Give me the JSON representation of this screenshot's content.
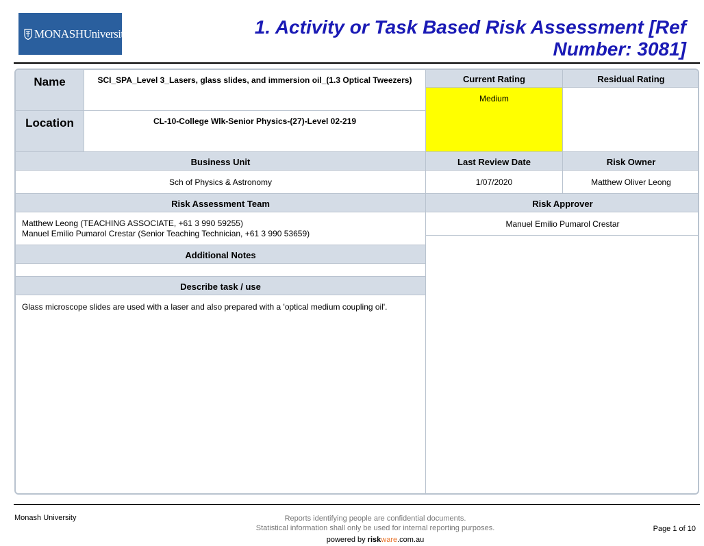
{
  "header": {
    "logo_main": "MONASH",
    "logo_sub": "University",
    "title": "1. Activity or Task Based Risk Assessment [Ref Number: 3081]"
  },
  "form": {
    "name_label": "Name",
    "name_value": "SCI_SPA_Level 3_Lasers, glass slides, and immersion oil_(1.3 Optical Tweezers)",
    "location_label": "Location",
    "location_value": "CL-10-College Wlk-Senior Physics-(27)-Level 02-219",
    "current_rating_label": "Current Rating",
    "current_rating_value": "Medium",
    "current_rating_color": "#ffff00",
    "residual_rating_label": "Residual Rating",
    "residual_rating_value": "",
    "business_unit_label": "Business Unit",
    "business_unit_value": "Sch of Physics & Astronomy",
    "last_review_label": "Last Review Date",
    "last_review_value": "1/07/2020",
    "risk_owner_label": "Risk Owner",
    "risk_owner_value": "Matthew Oliver Leong",
    "team_label": "Risk Assessment Team",
    "team_members": [
      "Matthew Leong (TEACHING ASSOCIATE, +61 3 990 59255)",
      "Manuel Emilio Pumarol Crestar (Senior Teaching Technician, +61 3 990 53659)"
    ],
    "approver_label": "Risk Approver",
    "approver_value": "Manuel Emilio Pumarol Crestar",
    "notes_label": "Additional Notes",
    "notes_value": "",
    "task_label": "Describe task / use",
    "task_value": "Glass microscope slides are used with a laser and also prepared with a 'optical medium coupling oil'."
  },
  "footer": {
    "org": "Monash University",
    "notice_line1": "Reports identifying people are confidential documents.",
    "notice_line2": "Statistical information shall only be used for internal reporting purposes.",
    "powered_prefix": "powered by ",
    "powered_risk": "risk",
    "powered_ware": "ware",
    "powered_suffix": ".com.au",
    "page": "Page 1 of 10"
  },
  "colors": {
    "header_bg": "#d4dce6",
    "border": "#b9c3cf",
    "title": "#1a1ab5",
    "logo_bg": "#2a5f9e"
  }
}
